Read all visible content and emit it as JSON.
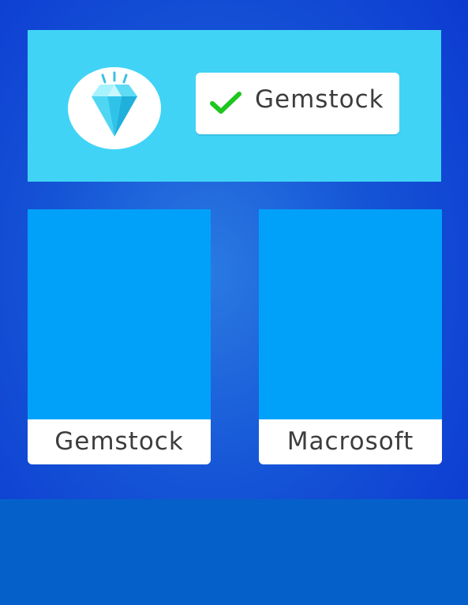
{
  "header": {
    "logo_icon": "diamond-icon",
    "selected_icon": "checkmark-icon",
    "selected_label": "Gemstock"
  },
  "cards": [
    {
      "label": "Gemstock"
    },
    {
      "label": "Macrosoft"
    }
  ],
  "colors": {
    "background": "#0b35d0",
    "floor": "#0561c9",
    "header_panel": "#40d3f6",
    "card_image": "#02a1f9",
    "check": "#1ec61e",
    "label_bg": "#ffffff",
    "text": "#3d3d3d"
  }
}
